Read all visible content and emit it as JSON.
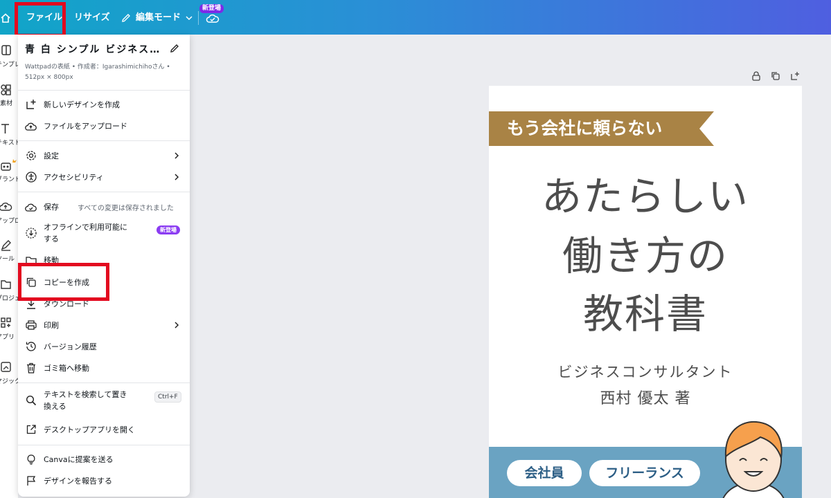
{
  "topbar": {
    "file_label": "ファイル",
    "resize_label": "リサイズ",
    "edit_mode_label": "編集モード",
    "new_badge": "新登場"
  },
  "rail": {
    "items": [
      {
        "label": "テンプレート",
        "icon": "template-icon"
      },
      {
        "label": "素材",
        "icon": "elements-icon"
      },
      {
        "label": "テキスト",
        "icon": "text-icon"
      },
      {
        "label": "ブランド",
        "icon": "brand-icon"
      },
      {
        "label": "アップロード",
        "icon": "upload-icon"
      },
      {
        "label": "ツール",
        "icon": "tools-icon"
      },
      {
        "label": "プロジェクト",
        "icon": "folder-icon"
      },
      {
        "label": "アプリ",
        "icon": "apps-icon"
      },
      {
        "label": "マジック生成",
        "icon": "magic-icon"
      }
    ]
  },
  "menu": {
    "design_title": "青 白 シンプル ビジネス…",
    "design_meta_line1": "Wattpadの表紙 • 作成者：Igarashimichihoさん •",
    "design_meta_line2": "512px × 800px",
    "new_design": "新しいデザインを作成",
    "upload_file": "ファイルをアップロード",
    "settings": "設定",
    "accessibility": "アクセシビリティ",
    "save": "保存",
    "save_status": "すべての変更は保存されました",
    "offline": "オフラインで利用可能にする",
    "offline_badge": "新登場",
    "move": "移動",
    "make_copy": "コピーを作成",
    "download": "ダウンロード",
    "print": "印刷",
    "version_history": "バージョン履歴",
    "trash": "ゴミ箱へ移動",
    "find_replace": "テキストを検索して置き換える",
    "find_replace_shortcut": "Ctrl+F",
    "open_desktop": "デスクトップアプリを開く",
    "send_feedback": "Canvaに提案を送る",
    "report_design": "デザインを報告する"
  },
  "canvas": {
    "banner": "もう会社に頼らない",
    "title_line1": "あたらしい",
    "title_line2": "働き方の",
    "title_line3": "教科書",
    "author_role": "ビジネスコンサルタント",
    "author_name": "西村 優太 著",
    "tag1": "会社員",
    "tag2": "フリーランス"
  },
  "colors": {
    "topbar_start": "#11a5c8",
    "topbar_end": "#4f5fe0",
    "highlight": "#e3091f",
    "banner": "#a98345",
    "title_text": "#4d4d4d",
    "bottom_band": "#6aa3c2",
    "tag_text": "#2d5f86",
    "new_badge": "#8b3cf2"
  }
}
